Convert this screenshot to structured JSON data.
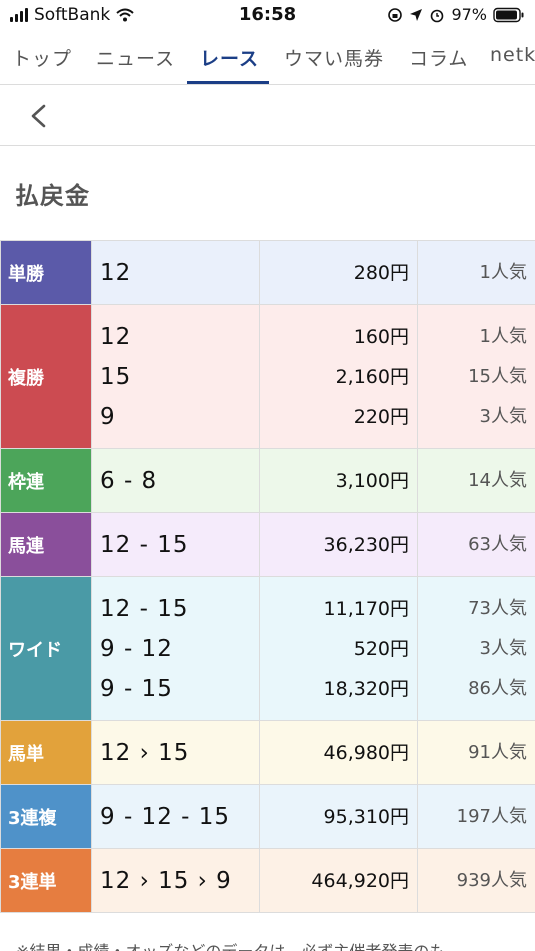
{
  "status_bar": {
    "carrier": "SoftBank",
    "time": "16:58",
    "battery": "97%",
    "icons": [
      "signal-icon",
      "wifi-icon",
      "rotation-lock-icon",
      "location-icon",
      "alarm-icon",
      "battery-icon"
    ]
  },
  "tabs": [
    "トップ",
    "ニュース",
    "レース",
    "ウマい馬券",
    "コラム",
    "netk"
  ],
  "active_tab": "レース",
  "section_title": "払戻金",
  "payouts": [
    {
      "type": "単勝",
      "color": "#5b5aa9",
      "bg": "#eaf0fb",
      "rows": [
        {
          "num": "12",
          "pay": "280円",
          "pop": "1人気"
        }
      ]
    },
    {
      "type": "複勝",
      "color": "#cc4b51",
      "bg": "#fdeceb",
      "rows": [
        {
          "num": "12",
          "pay": "160円",
          "pop": "1人気"
        },
        {
          "num": "15",
          "pay": "2,160円",
          "pop": "15人気"
        },
        {
          "num": "9",
          "pay": "220円",
          "pop": "3人気"
        }
      ]
    },
    {
      "type": "枠連",
      "color": "#4ca55a",
      "bg": "#edf8ea",
      "rows": [
        {
          "num": "6-8",
          "pay": "3,100円",
          "pop": "14人気"
        }
      ]
    },
    {
      "type": "馬連",
      "color": "#8a4f9b",
      "bg": "#f5ebfb",
      "rows": [
        {
          "num": "12-15",
          "pay": "36,230円",
          "pop": "63人気"
        }
      ]
    },
    {
      "type": "ワイド",
      "color": "#4a9aa6",
      "bg": "#e9f7fb",
      "rows": [
        {
          "num": "12-15",
          "pay": "11,170円",
          "pop": "73人気"
        },
        {
          "num": "9-12",
          "pay": "520円",
          "pop": "3人気"
        },
        {
          "num": "9-15",
          "pay": "18,320円",
          "pop": "86人気"
        }
      ]
    },
    {
      "type": "馬単",
      "color": "#e2a23b",
      "bg": "#fdf9e8",
      "rows": [
        {
          "num": "12>15",
          "pay": "46,980円",
          "pop": "91人気"
        }
      ]
    },
    {
      "type": "3連複",
      "color": "#4f92c9",
      "bg": "#eaf4fb",
      "rows": [
        {
          "num": "9-12-15",
          "pay": "95,310円",
          "pop": "197人気"
        }
      ]
    },
    {
      "type": "3連単",
      "color": "#e67d40",
      "bg": "#fdf1e6",
      "rows": [
        {
          "num": "12>15>9",
          "pay": "464,920円",
          "pop": "939人気"
        }
      ]
    }
  ],
  "footnote": "※結果・成績・オッズなどのデータは、必ず主催者発表のも"
}
